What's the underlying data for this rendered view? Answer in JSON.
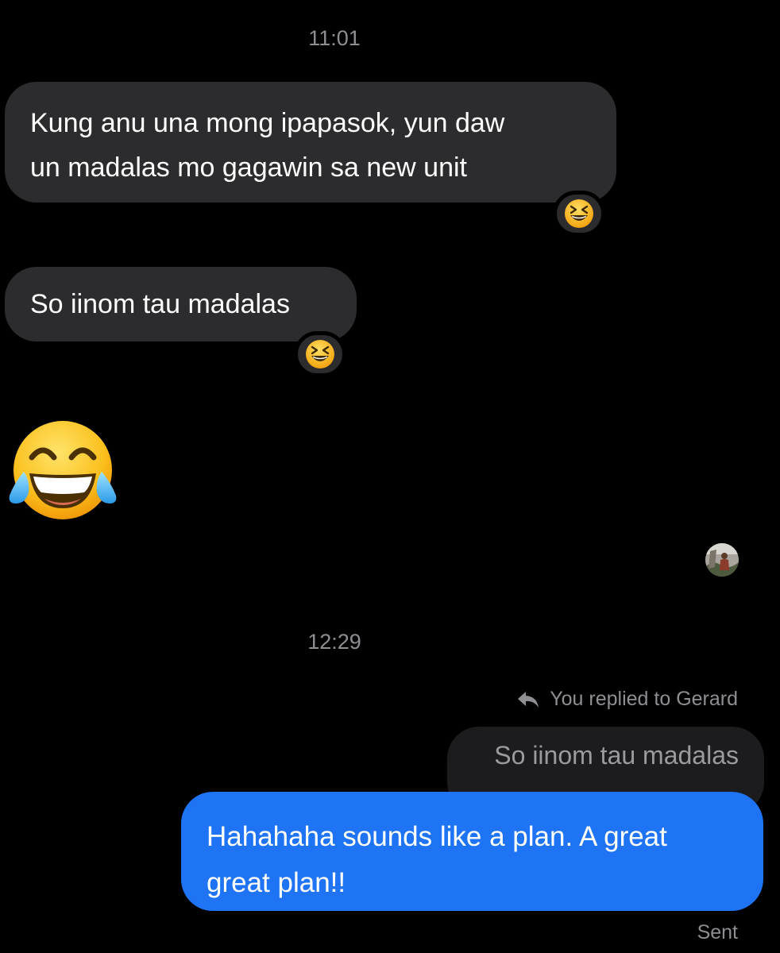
{
  "conversation": {
    "timestamps": [
      "11:01",
      "12:29"
    ],
    "incoming": [
      {
        "lines": [
          "Kung anu una mong ipapasok, yun daw",
          "un madalas mo gagawin sa new unit"
        ],
        "reaction": "grinning-squinting-face-emoji"
      },
      {
        "lines": [
          "So iinom tau madalas"
        ],
        "reaction": "grinning-squinting-face-emoji"
      }
    ],
    "big_emoji": "face-with-tears-of-joy-emoji",
    "reply": {
      "label": "You replied to Gerard",
      "quoted_text": "So iinom tau madalas"
    },
    "outgoing": {
      "lines": [
        "Hahahaha sounds like a plan. A great",
        "great plan!!"
      ]
    },
    "status": "Sent"
  },
  "colors": {
    "background": "#000000",
    "incoming_bubble": "#2c2c2e",
    "outgoing_bubble": "#1f74f5",
    "quoted_bubble": "#1c1c1e",
    "meta_text": "#8e8e93"
  }
}
